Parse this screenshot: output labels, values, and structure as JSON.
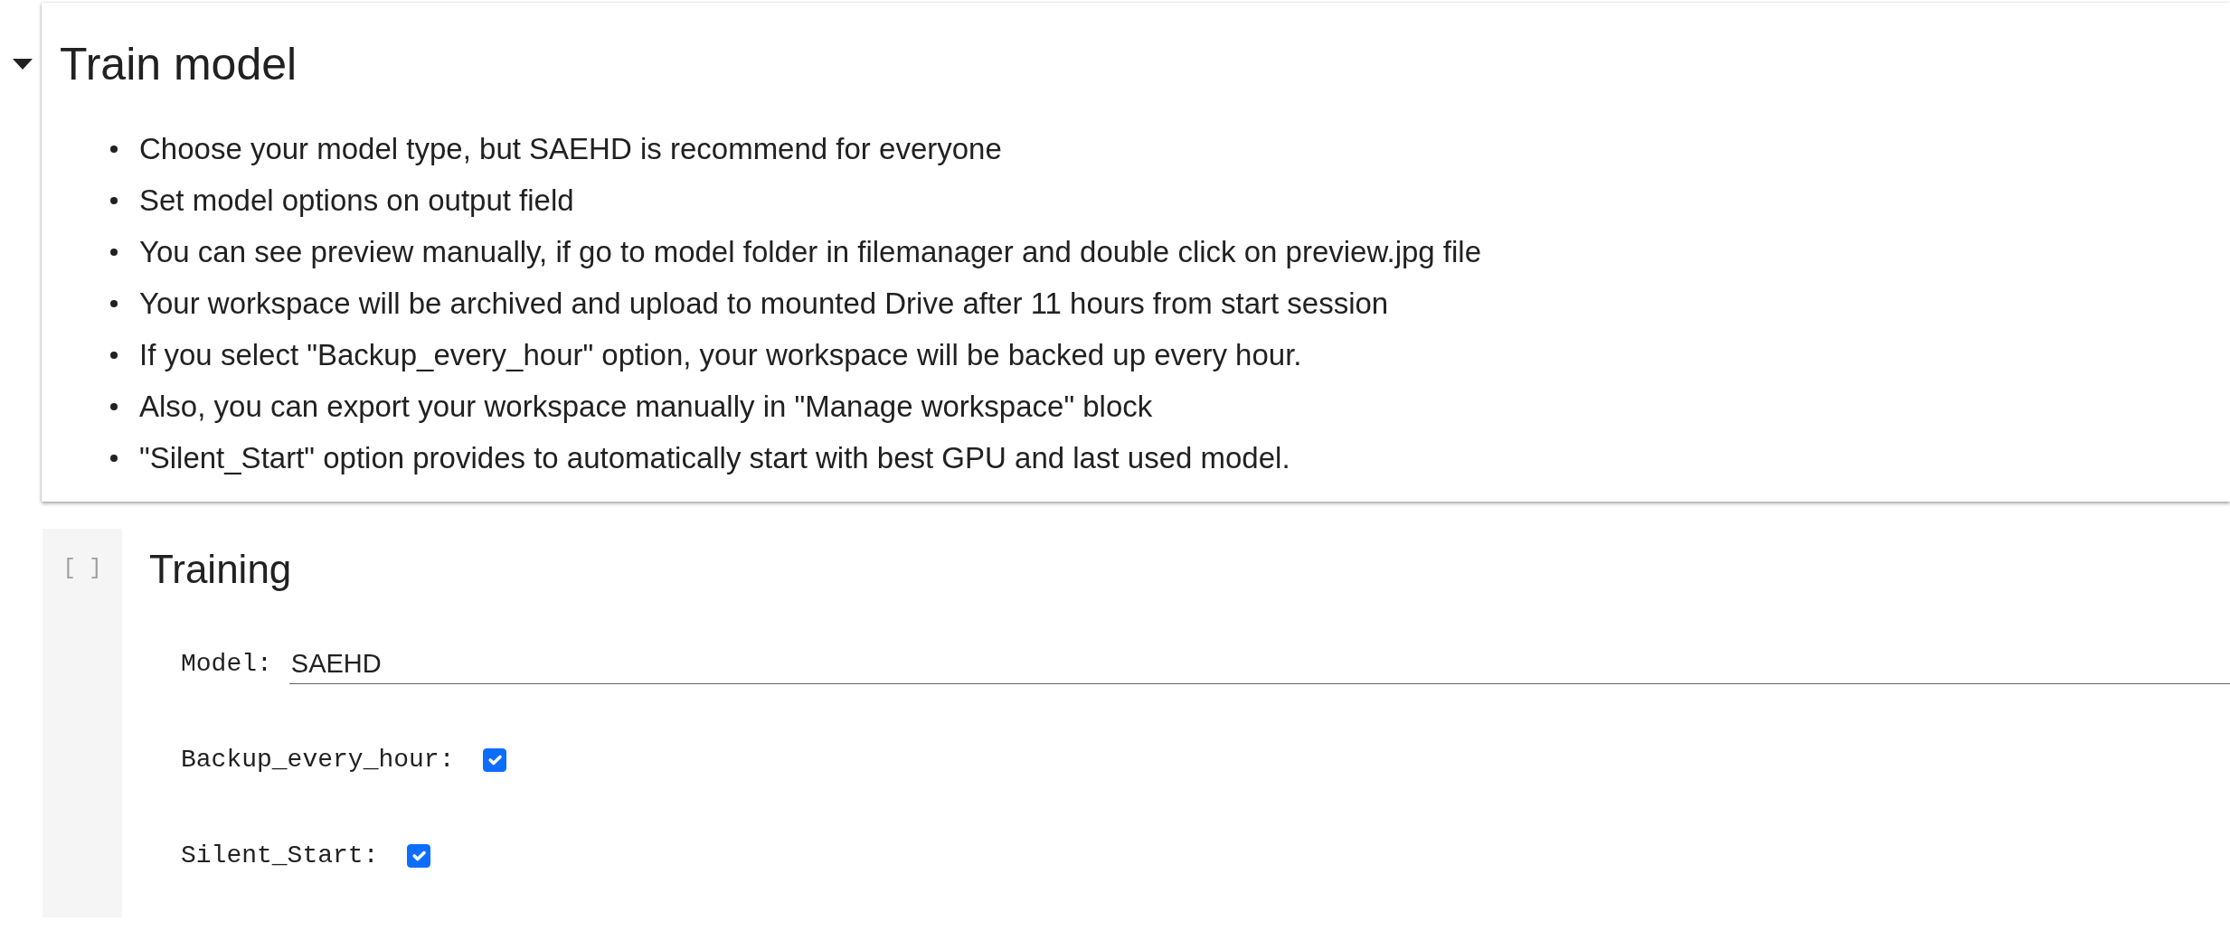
{
  "section": {
    "title": "Train model",
    "expanded": true,
    "bullets": [
      "Choose your model type, but SAEHD is recommend for everyone",
      "Set model options on output field",
      "You can see preview manually, if go to model folder in filemanager and double click on preview.jpg file",
      "Your workspace will be archived and upload to mounted Drive after 11 hours from start session",
      "If you select \"Backup_every_hour\" option, your workspace will be backed up every hour.",
      "Also, you can export your workspace manually in \"Manage workspace\" block",
      "\"Silent_Start\" option provides to automatically start with best GPU and last used model."
    ]
  },
  "cell": {
    "prompt": "[ ]",
    "title": "Training",
    "fields": [
      {
        "kind": "text",
        "label": "Model:",
        "value": "SAEHD"
      },
      {
        "kind": "checkbox",
        "label": "Backup_every_hour:",
        "checked": true
      },
      {
        "kind": "checkbox",
        "label": "Silent_Start:",
        "checked": true
      }
    ]
  }
}
